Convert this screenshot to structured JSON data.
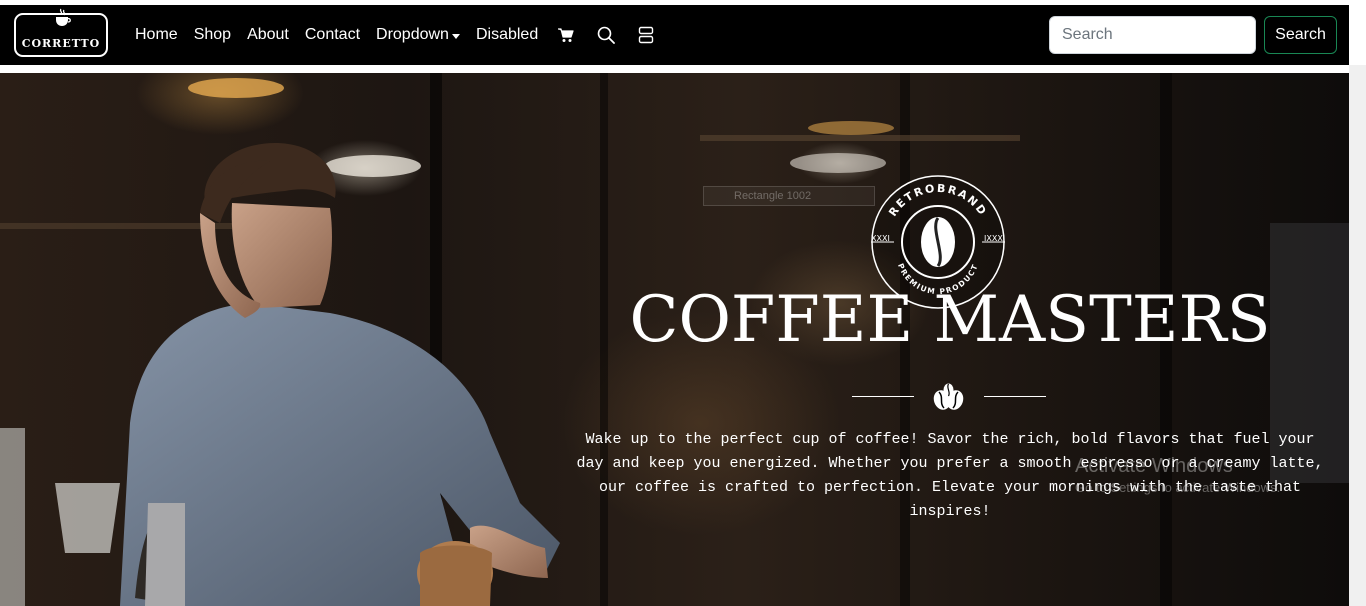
{
  "brand": {
    "name": "CORRETTO"
  },
  "nav": {
    "links": [
      {
        "label": "Home"
      },
      {
        "label": "Shop"
      },
      {
        "label": "About"
      },
      {
        "label": "Contact"
      },
      {
        "label": "Dropdown"
      },
      {
        "label": "Disabled"
      }
    ],
    "icons": [
      "cart-icon",
      "search-icon",
      "layout-icon"
    ]
  },
  "search": {
    "placeholder": "Search",
    "value": "",
    "button_label": "Search"
  },
  "hero": {
    "emblem": {
      "top_text": "RETROBRAND",
      "left_text": "XXXI",
      "right_text": "IXXX",
      "bottom_text": "PREMIUM PRODUCT"
    },
    "ghost_label": "Rectangle 1002",
    "title": "COFFEE MASTERS",
    "description": "Wake up to the perfect cup of coffee! Savor the rich, bold flavors that fuel your day and keep you energized. Whether you prefer a smooth espresso or a creamy latte, our coffee is crafted to perfection. Elevate your mornings with the taste that inspires!"
  },
  "watermark": {
    "title": "Activate Windows",
    "subtitle": "Go to Settings to activate Windows."
  },
  "colors": {
    "navbar": "#000000",
    "search_button_border": "#198754",
    "text": "#ffffff"
  }
}
